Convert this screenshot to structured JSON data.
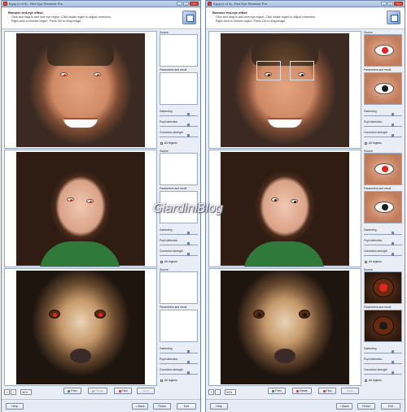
{
  "left_window": {
    "title": "5.jpg (1 of 3) - Red Eye Remover Pro",
    "header": {
      "title": "Remove red-eye effect",
      "line1": "Click and drag to add new eye region. Click inside region to adjust correction.",
      "line2": "Right-click to remove region. Press Ctrl to drag image."
    },
    "rows": [
      {
        "source_label": "Source",
        "params_label": "Parameters and result",
        "darkening": "Darkening",
        "pupil": "Pupil detection",
        "strength": "Correction strength",
        "all_regions": "All regions"
      },
      {
        "source_label": "Source",
        "params_label": "Parameters and result",
        "darkening": "Darkening",
        "pupil": "Pupil detection",
        "strength": "Correction strength",
        "all_regions": "All regions"
      },
      {
        "source_label": "Source",
        "params_label": "Parameters and result",
        "darkening": "Darkening",
        "pupil": "Pupil detection",
        "strength": "Correction strength",
        "all_regions": "All regions"
      }
    ],
    "zoom": "50%",
    "buttons": {
      "prev": "Prev",
      "reset": "Reset",
      "find": "Find",
      "next": "Next",
      "help": "Help",
      "back": "< Back",
      "finish": "Finish",
      "exit": "Exit"
    }
  },
  "right_window": {
    "title": "5.jpg (1 of 3) - Red Eye Remover Pro",
    "header": {
      "title": "Remove red-eye effect",
      "line1": "Click and drag to add new eye region. Click inside region to adjust correction.",
      "line2": "Right-click to remove region. Press Ctrl to drag image."
    },
    "rows": [
      {
        "source_label": "Source",
        "params_label": "Parameters and result",
        "darkening": "Darkening",
        "pupil": "Pupil detection",
        "strength": "Correction strength",
        "all_regions": "All regions"
      },
      {
        "source_label": "Source",
        "params_label": "Parameters and result",
        "darkening": "Darkening",
        "pupil": "Pupil detection",
        "strength": "Correction strength",
        "all_regions": "All regions"
      },
      {
        "source_label": "Source",
        "params_label": "Parameters and result",
        "darkening": "Darkening",
        "pupil": "Pupil detection",
        "strength": "Correction strength",
        "all_regions": "All regions"
      }
    ],
    "zoom": "50%",
    "buttons": {
      "prev": "Prev",
      "reset": "Reset",
      "find": "Find",
      "next": "Next",
      "help": "Help",
      "back": "< Back",
      "finish": "Finish",
      "exit": "Exit"
    }
  },
  "watermark": "GiardiniBlog",
  "colors": {
    "red_pupil": "#e8231e",
    "fixed_pupil": "#1a1a1a",
    "accent": "#6f86a8"
  },
  "icons": {
    "app": "red-eye-app-icon",
    "header": "eye-tool-icon",
    "zoom_in": "zoom-in-icon",
    "zoom_out": "zoom-out-icon",
    "fit": "fit-icon"
  }
}
